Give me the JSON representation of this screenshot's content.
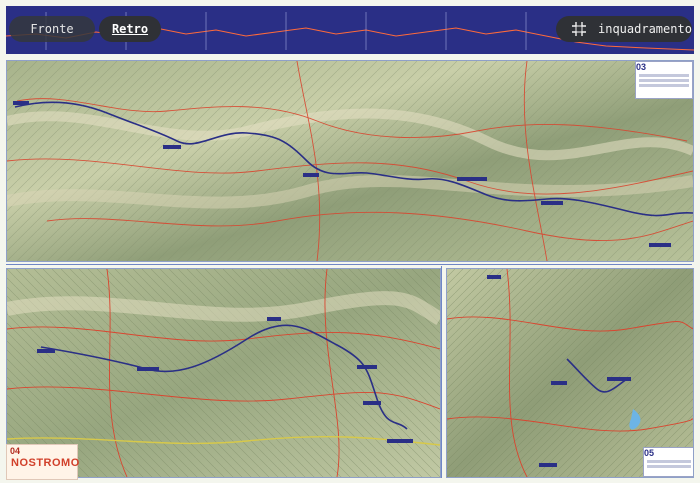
{
  "toolbar": {
    "front_label": "Fronte",
    "back_label": "Retro",
    "frame_label": "inquadramento",
    "frame_icon": "crop-frame-icon"
  },
  "sheets": [
    {
      "number": "03"
    },
    {
      "number": "04"
    },
    {
      "number": "05"
    }
  ],
  "brand": {
    "name": "NOSTROMO",
    "code": "04"
  },
  "colors": {
    "profile_bg": "#2a2f86",
    "route": "#2a2f86",
    "roads": "#d9452f",
    "accent": "#d1402a"
  }
}
